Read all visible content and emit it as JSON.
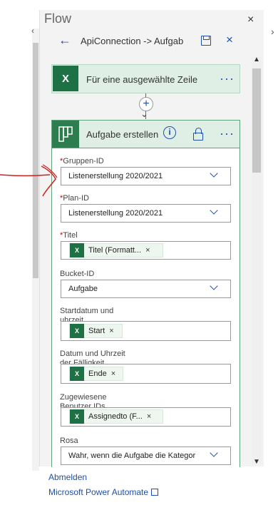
{
  "panel": {
    "title": "Flow"
  },
  "header": {
    "title": "ApiConnection -> Aufgab"
  },
  "trigger_card": {
    "title": "Für eine ausgewählte Zeile",
    "more": "···"
  },
  "insert": {
    "plus": "+"
  },
  "action_card": {
    "title": "Aufgabe erstellen",
    "more": "···",
    "fields": [
      {
        "label": "Gruppen-ID",
        "required": "*",
        "value": "Listenerstellung 2020/2021"
      },
      {
        "label": "Plan-ID",
        "required": "*",
        "value": "Listenerstellung 2020/2021"
      },
      {
        "label": "Titel",
        "required": "*",
        "token": "Titel (Formatt...",
        "token_close": "×"
      },
      {
        "label": "Bucket-ID",
        "value": "Aufgabe"
      },
      {
        "label_line1": "Startdatum und",
        "label_line2": "uhrzeit",
        "token": "Start",
        "token_close": "×"
      },
      {
        "label_line1": "Datum und Uhrzeit",
        "label_line2": "der Fälligkeit",
        "token": "Ende",
        "token_close": "×"
      },
      {
        "label_line1": "Zugewiesene",
        "label_line2": "Benutzer IDs",
        "token": "Assignedto (F...",
        "token_close": "×"
      },
      {
        "label": "Rosa",
        "value": "Wahr, wenn die Aufgabe die Kategor"
      }
    ]
  },
  "footer": {
    "signout": "Abmelden",
    "power_automate": "Microsoft Power Automate"
  },
  "icons": {
    "excel": "X",
    "close": "×"
  },
  "colors": {
    "accent": "#1f4fa8",
    "excel_green": "#1e7145",
    "card_header": "#e0efe6",
    "annotation": "#d02020"
  }
}
